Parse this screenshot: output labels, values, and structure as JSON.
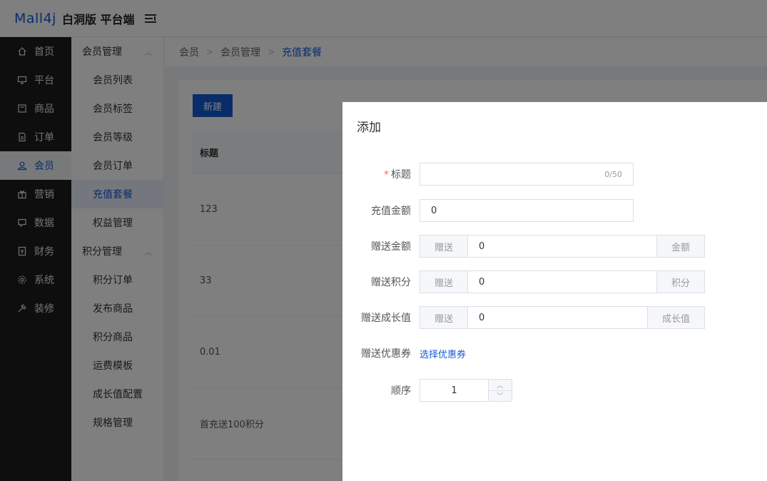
{
  "header": {
    "logo": "Mall4j",
    "edition": "白洞版 平台端"
  },
  "nav": [
    {
      "label": "首页",
      "icon": "home-icon"
    },
    {
      "label": "平台",
      "icon": "monitor-icon"
    },
    {
      "label": "商品",
      "icon": "product-icon"
    },
    {
      "label": "订单",
      "icon": "order-icon"
    },
    {
      "label": "会员",
      "icon": "member-icon",
      "active": true
    },
    {
      "label": "营销",
      "icon": "gift-icon"
    },
    {
      "label": "数据",
      "icon": "data-icon"
    },
    {
      "label": "财务",
      "icon": "finance-icon"
    },
    {
      "label": "系统",
      "icon": "gear-icon"
    },
    {
      "label": "装修",
      "icon": "decorate-icon"
    }
  ],
  "subnav": {
    "group1": "会员管理",
    "items1": [
      "会员列表",
      "会员标签",
      "会员等级",
      "会员订单",
      "充值套餐",
      "权益管理"
    ],
    "group2": "积分管理",
    "items2": [
      "积分订单",
      "发布商品",
      "积分商品",
      "运费模板",
      "成长值配置",
      "规格管理"
    ]
  },
  "breadcrumb": [
    "会员",
    "会员管理",
    "充值套餐"
  ],
  "toolbar": {
    "new_label": "新建"
  },
  "table": {
    "header": "标题",
    "rows": [
      "123",
      "33",
      "0.01",
      "首充送100积分"
    ]
  },
  "dialog": {
    "title": "添加",
    "title_label": "标题",
    "title_counter": "0/50",
    "amount_label": "充值金额",
    "amount_value": "0",
    "gift_amount_label": "赠送金额",
    "gift_amount_prefix": "赠送",
    "gift_amount_value": "0",
    "gift_amount_suffix": "金额",
    "gift_points_label": "赠送积分",
    "gift_points_prefix": "赠送",
    "gift_points_value": "0",
    "gift_points_suffix": "积分",
    "gift_growth_label": "赠送成长值",
    "gift_growth_prefix": "赠送",
    "gift_growth_value": "0",
    "gift_growth_suffix": "成长值",
    "coupon_label": "赠送优惠券",
    "coupon_link": "选择优惠券",
    "order_label": "顺序",
    "order_value": "1"
  },
  "colors": {
    "accent": "#155bd4",
    "nav_bg": "#1c1c1c",
    "required": "#f56c6c"
  }
}
